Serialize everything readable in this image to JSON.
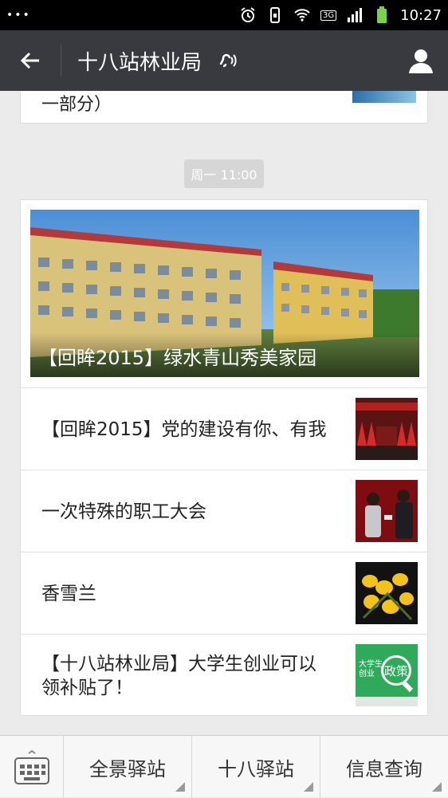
{
  "status_bar": {
    "left_dots": "•••",
    "network": "3G",
    "time": "10:27"
  },
  "app_bar": {
    "title": "十八站林业局"
  },
  "previous_item": {
    "text": "一部分）"
  },
  "timestamp": "周一 11:00",
  "news": {
    "hero_title": "【回眸2015】绿水青山秀美家园",
    "items": [
      {
        "title": "【回眸2015】党的建设有你、有我",
        "thumb": "meeting-stage"
      },
      {
        "title": "一次特殊的职工大会",
        "thumb": "award-ceremony"
      },
      {
        "title": "香雪兰",
        "thumb": "yellow-flowers"
      },
      {
        "title": "【十八站林业局】大学生创业可以领补贴了！",
        "thumb": "policy-graphic"
      }
    ]
  },
  "thumb_texts": {
    "policy_small": "大学生\n创业",
    "policy_big": "政策"
  },
  "bottom_menu": {
    "items": [
      "全景驿站",
      "十八驿站",
      "信息查询"
    ]
  },
  "colors": {
    "app_bar": "#393a3f",
    "background": "#ebebeb",
    "policy_green": "#2eaa5a"
  }
}
